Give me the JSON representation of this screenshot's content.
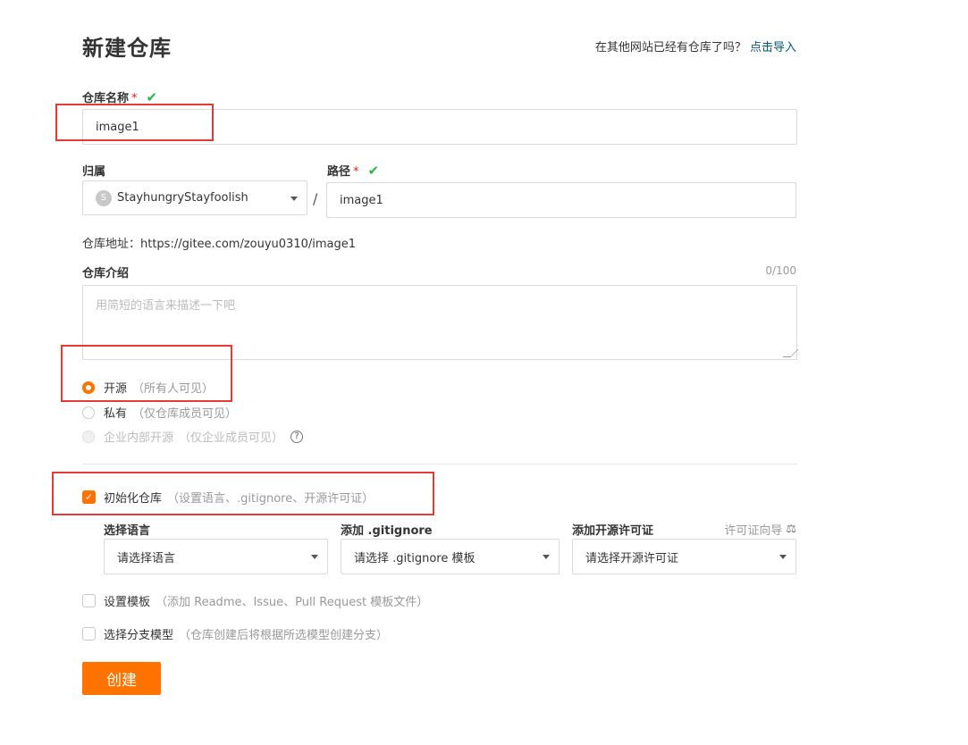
{
  "page": {
    "title": "新建仓库",
    "import_question": "在其他网站已经有仓库了吗？",
    "import_link": "点击导入"
  },
  "repo_name": {
    "label": "仓库名称",
    "required_mark": "*",
    "value": "image1"
  },
  "owner": {
    "label": "归属",
    "avatar_letter": "S",
    "value": "StayhungryStayfoolish"
  },
  "separator": "/",
  "path": {
    "label": "路径",
    "required_mark": "*",
    "value": "image1"
  },
  "repo_address": "仓库地址：https://gitee.com/zouyu0310/image1",
  "description": {
    "label": "仓库介绍",
    "counter": "0/100",
    "placeholder": "用简短的语言来描述一下吧"
  },
  "visibility": {
    "options": [
      {
        "label": "开源",
        "hint": "（所有人可见）",
        "checked": true,
        "disabled": false
      },
      {
        "label": "私有",
        "hint": "（仅仓库成员可见）",
        "checked": false,
        "disabled": false
      },
      {
        "label": "企业内部开源",
        "hint": "（仅企业成员可见）",
        "checked": false,
        "disabled": true
      }
    ],
    "help_icon": "question-circle-icon"
  },
  "init_repo": {
    "label": "初始化仓库",
    "hint": "（设置语言、.gitignore、开源许可证）",
    "checked": true
  },
  "language": {
    "label": "选择语言",
    "value": "请选择语言"
  },
  "gitignore": {
    "label": "添加 .gitignore",
    "value": "请选择 .gitignore 模板"
  },
  "license": {
    "label": "添加开源许可证",
    "guide": "许可证向导",
    "guide_icon": "scale-icon",
    "value": "请选择开源许可证"
  },
  "template": {
    "label": "设置模板",
    "hint": "（添加 Readme、Issue、Pull Request 模板文件）",
    "checked": false
  },
  "branch_model": {
    "label": "选择分支模型",
    "hint": "（仓库创建后将根据所选模型创建分支）",
    "checked": false
  },
  "create_button": "创建",
  "colors": {
    "accent": "#fe7300",
    "highlight_box": "#e53935",
    "valid_check": "#21ba45",
    "link": "#005980"
  }
}
